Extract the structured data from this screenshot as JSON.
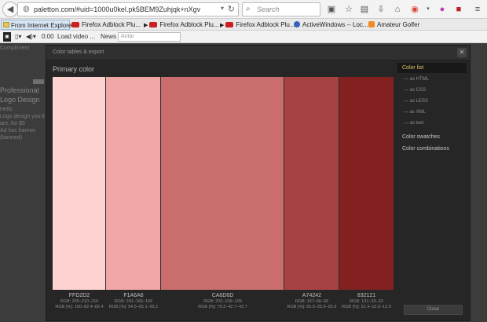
{
  "browser": {
    "url": "paletton.com/#uid=1000u0kel.pk5BEM9Zuhjqk+nXgv",
    "search_placeholder": "Search"
  },
  "bookmarks": [
    {
      "label": "From Internet Explorer",
      "icon": "folder-icon"
    },
    {
      "label": "Firefox Adblock Plu...",
      "icon": "youtube-icon"
    },
    {
      "label": "Firefox Adblock Plu...",
      "icon": "youtube-icon"
    },
    {
      "label": "Firefox Adblock Plu...",
      "icon": "youtube-icon"
    },
    {
      "label": "ActiveWindows -- Loc...",
      "icon": "activewindows-icon"
    },
    {
      "label": "Amateur Golfer",
      "icon": "blogger-icon"
    }
  ],
  "mediabar": {
    "time": "0:00",
    "load_label": "Load video ...",
    "news_label": "News",
    "news_placeholder": "Antar"
  },
  "background_page": {
    "lines": [
      "Compliment",
      "Professional",
      "Logo Design",
      "Hello ",
      "Logo design you'd",
      "are, for $5",
      "Ad hoc banner",
      "(banned)"
    ]
  },
  "modal": {
    "title": "Color tables & export",
    "section_title": "Primary color",
    "swatches": [
      {
        "hex": "FFD2D2",
        "color": "#FFD2D2",
        "rgb": "RGB: 255–210–210",
        "rgb_pct": "RGB [%]: 100–82.4–82.4"
      },
      {
        "hex": "F1A6A6",
        "color": "#F1A6A6",
        "rgb": "RGB: 241–166–166",
        "rgb_pct": "RGB [%]: 94.5–65.1–65.1"
      },
      {
        "hex": "CA6D6D",
        "color": "#CA6D6D",
        "rgb": "RGB: 202–109–109",
        "rgb_pct": "RGB [%]: 79.2–42.7–42.7"
      },
      {
        "hex": "A74242",
        "color": "#A74242",
        "rgb": "RGB: 167–66–66",
        "rgb_pct": "RGB [%]: 65.5–25.9–25.9"
      },
      {
        "hex": "832121",
        "color": "#832121",
        "rgb": "RGB: 131–33–33",
        "rgb_pct": "RGB [%]: 51.4–12.9–12.9"
      }
    ],
    "menu": {
      "color_list": "Color list",
      "sub_items": [
        "as HTML",
        "as CSS",
        "as LESS",
        "as XML",
        "as text"
      ],
      "color_swatches": "Color swatches",
      "color_combinations": "Color combinations"
    },
    "close_label": "Close"
  }
}
